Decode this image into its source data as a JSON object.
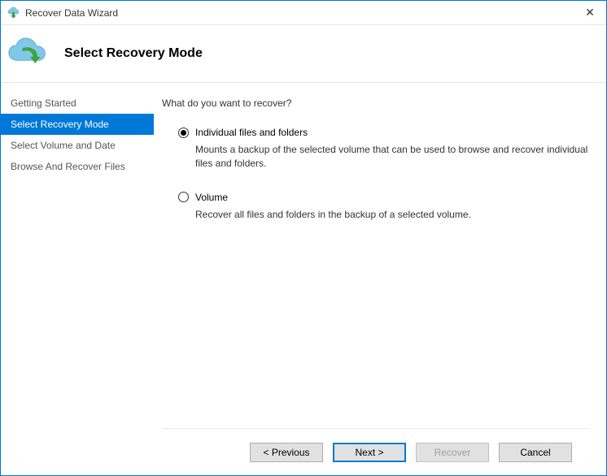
{
  "window": {
    "title": "Recover Data Wizard"
  },
  "header": {
    "title": "Select Recovery Mode"
  },
  "sidebar": {
    "steps": [
      {
        "label": "Getting Started",
        "active": false
      },
      {
        "label": "Select Recovery Mode",
        "active": true
      },
      {
        "label": "Select Volume and Date",
        "active": false
      },
      {
        "label": "Browse And Recover Files",
        "active": false
      }
    ]
  },
  "main": {
    "question": "What do you want to recover?",
    "options": [
      {
        "label": "Individual files and folders",
        "description": "Mounts a backup of the selected volume that can be used to browse and recover individual files and folders.",
        "selected": true
      },
      {
        "label": "Volume",
        "description": "Recover all files and folders in the backup of a selected volume.",
        "selected": false
      }
    ]
  },
  "footer": {
    "previous": "< Previous",
    "next": "Next >",
    "recover": "Recover",
    "cancel": "Cancel"
  }
}
